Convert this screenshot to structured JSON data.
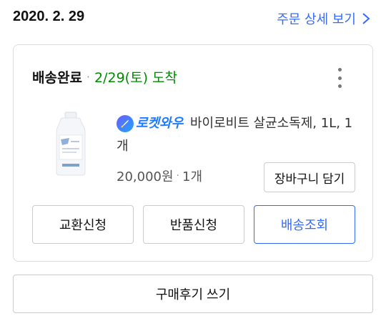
{
  "header": {
    "date": "2020. 2. 29",
    "detail_link": "주문 상세 보기"
  },
  "order": {
    "status": "배송완료",
    "separator": "·",
    "arrival": "2/29(토) 도착",
    "badge_text": "로켓와우",
    "product_name": "바이로비트 살균소독제, 1L, 1개",
    "price": "20,000원",
    "quantity": "1개",
    "cart_button": "장바구니 담기",
    "actions": {
      "exchange": "교환신청",
      "return": "반품신청",
      "tracking": "배송조회"
    }
  },
  "review_button": "구매후기 쓰기",
  "colors": {
    "accent": "#346aff",
    "arrival": "#008c00",
    "border": "#dddddd"
  },
  "icons": [
    "chevron-right-icon",
    "more-vertical-icon",
    "rocket-icon",
    "product-bottle-image"
  ]
}
